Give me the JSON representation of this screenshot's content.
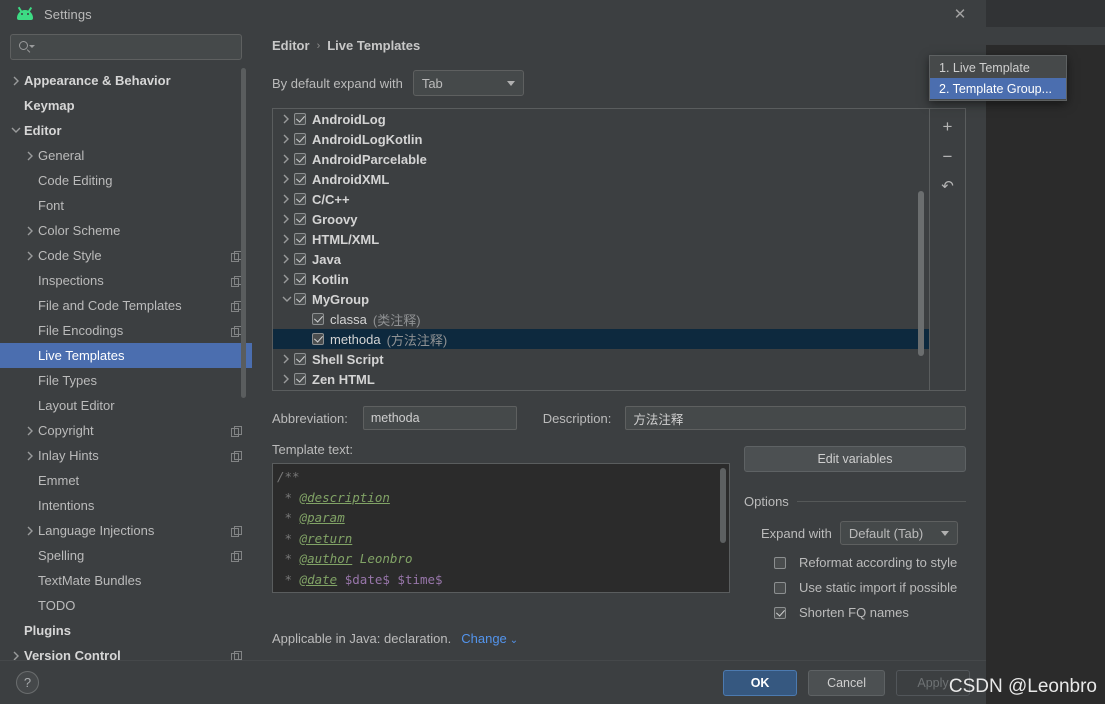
{
  "window": {
    "title": "Settings",
    "app_icon": "android-icon",
    "close_icon": "close-icon"
  },
  "search": {
    "value": "",
    "placeholder": "",
    "icon": "search-icon"
  },
  "sidebar": {
    "items": [
      {
        "label": "Appearance & Behavior",
        "twisty": "collapsed",
        "indent": 0,
        "bold": true,
        "copy": false,
        "selected": false
      },
      {
        "label": "Keymap",
        "twisty": "none",
        "indent": 0,
        "bold": true,
        "copy": false,
        "selected": false
      },
      {
        "label": "Editor",
        "twisty": "expanded",
        "indent": 0,
        "bold": true,
        "copy": false,
        "selected": false
      },
      {
        "label": "General",
        "twisty": "collapsed",
        "indent": 1,
        "bold": false,
        "copy": false,
        "selected": false
      },
      {
        "label": "Code Editing",
        "twisty": "none",
        "indent": 1,
        "bold": false,
        "copy": false,
        "selected": false
      },
      {
        "label": "Font",
        "twisty": "none",
        "indent": 1,
        "bold": false,
        "copy": false,
        "selected": false
      },
      {
        "label": "Color Scheme",
        "twisty": "collapsed",
        "indent": 1,
        "bold": false,
        "copy": false,
        "selected": false
      },
      {
        "label": "Code Style",
        "twisty": "collapsed",
        "indent": 1,
        "bold": false,
        "copy": true,
        "selected": false
      },
      {
        "label": "Inspections",
        "twisty": "none",
        "indent": 1,
        "bold": false,
        "copy": true,
        "selected": false
      },
      {
        "label": "File and Code Templates",
        "twisty": "none",
        "indent": 1,
        "bold": false,
        "copy": true,
        "selected": false
      },
      {
        "label": "File Encodings",
        "twisty": "none",
        "indent": 1,
        "bold": false,
        "copy": true,
        "selected": false
      },
      {
        "label": "Live Templates",
        "twisty": "none",
        "indent": 1,
        "bold": false,
        "copy": false,
        "selected": true
      },
      {
        "label": "File Types",
        "twisty": "none",
        "indent": 1,
        "bold": false,
        "copy": false,
        "selected": false
      },
      {
        "label": "Layout Editor",
        "twisty": "none",
        "indent": 1,
        "bold": false,
        "copy": false,
        "selected": false
      },
      {
        "label": "Copyright",
        "twisty": "collapsed",
        "indent": 1,
        "bold": false,
        "copy": true,
        "selected": false
      },
      {
        "label": "Inlay Hints",
        "twisty": "collapsed",
        "indent": 1,
        "bold": false,
        "copy": true,
        "selected": false
      },
      {
        "label": "Emmet",
        "twisty": "none",
        "indent": 1,
        "bold": false,
        "copy": false,
        "selected": false
      },
      {
        "label": "Intentions",
        "twisty": "none",
        "indent": 1,
        "bold": false,
        "copy": false,
        "selected": false
      },
      {
        "label": "Language Injections",
        "twisty": "collapsed",
        "indent": 1,
        "bold": false,
        "copy": true,
        "selected": false
      },
      {
        "label": "Spelling",
        "twisty": "none",
        "indent": 1,
        "bold": false,
        "copy": true,
        "selected": false
      },
      {
        "label": "TextMate Bundles",
        "twisty": "none",
        "indent": 1,
        "bold": false,
        "copy": false,
        "selected": false
      },
      {
        "label": "TODO",
        "twisty": "none",
        "indent": 1,
        "bold": false,
        "copy": false,
        "selected": false
      },
      {
        "label": "Plugins",
        "twisty": "none",
        "indent": 0,
        "bold": true,
        "copy": false,
        "selected": false
      },
      {
        "label": "Version Control",
        "twisty": "collapsed",
        "indent": 0,
        "bold": true,
        "copy": true,
        "selected": false
      }
    ]
  },
  "main": {
    "breadcrumb": {
      "parent": "Editor",
      "separator": "›",
      "current": "Live Templates"
    },
    "expand_with": {
      "label": "By default expand with",
      "value": "Tab"
    },
    "template_tree": [
      {
        "label": "AndroidLog",
        "twisty": "collapsed",
        "checked": true,
        "indent": 0,
        "bold": true,
        "desc": "",
        "selected": false
      },
      {
        "label": "AndroidLogKotlin",
        "twisty": "collapsed",
        "checked": true,
        "indent": 0,
        "bold": true,
        "desc": "",
        "selected": false
      },
      {
        "label": "AndroidParcelable",
        "twisty": "collapsed",
        "checked": true,
        "indent": 0,
        "bold": true,
        "desc": "",
        "selected": false
      },
      {
        "label": "AndroidXML",
        "twisty": "collapsed",
        "checked": true,
        "indent": 0,
        "bold": true,
        "desc": "",
        "selected": false
      },
      {
        "label": "C/C++",
        "twisty": "collapsed",
        "checked": true,
        "indent": 0,
        "bold": true,
        "desc": "",
        "selected": false
      },
      {
        "label": "Groovy",
        "twisty": "collapsed",
        "checked": true,
        "indent": 0,
        "bold": true,
        "desc": "",
        "selected": false
      },
      {
        "label": "HTML/XML",
        "twisty": "collapsed",
        "checked": true,
        "indent": 0,
        "bold": true,
        "desc": "",
        "selected": false
      },
      {
        "label": "Java",
        "twisty": "collapsed",
        "checked": true,
        "indent": 0,
        "bold": true,
        "desc": "",
        "selected": false
      },
      {
        "label": "Kotlin",
        "twisty": "collapsed",
        "checked": true,
        "indent": 0,
        "bold": true,
        "desc": "",
        "selected": false
      },
      {
        "label": "MyGroup",
        "twisty": "expanded",
        "checked": true,
        "indent": 0,
        "bold": true,
        "desc": "",
        "selected": false
      },
      {
        "label": "classa",
        "twisty": "none",
        "checked": true,
        "indent": 1,
        "bold": false,
        "desc": "(类注释)",
        "selected": false
      },
      {
        "label": "methoda",
        "twisty": "none",
        "checked": true,
        "indent": 1,
        "bold": false,
        "desc": "(方法注释)",
        "selected": true
      },
      {
        "label": "Shell Script",
        "twisty": "collapsed",
        "checked": true,
        "indent": 0,
        "bold": true,
        "desc": "",
        "selected": false
      },
      {
        "label": "Zen HTML",
        "twisty": "collapsed",
        "checked": true,
        "indent": 0,
        "bold": true,
        "desc": "",
        "selected": false
      }
    ],
    "toolbar": {
      "add_label": "+",
      "remove_label": "−",
      "revert_label": "↶"
    },
    "add_menu": {
      "open": true,
      "items": [
        {
          "label": "1. Live Template",
          "highlighted": false
        },
        {
          "label": "2. Template Group...",
          "highlighted": true
        }
      ]
    },
    "abbreviation": {
      "label": "Abbreviation:",
      "value": "methoda"
    },
    "description": {
      "label": "Description:",
      "value": "方法注释"
    },
    "template_text": {
      "caption": "Template text:",
      "lines": [
        {
          "segments": [
            {
              "text": "/**",
              "style": "cm"
            }
          ]
        },
        {
          "segments": [
            {
              "text": " * ",
              "style": "cm"
            },
            {
              "text": "@description",
              "style": "tag"
            }
          ]
        },
        {
          "segments": [
            {
              "text": " * ",
              "style": "cm"
            },
            {
              "text": "@param",
              "style": "tag"
            }
          ]
        },
        {
          "segments": [
            {
              "text": " * ",
              "style": "cm"
            },
            {
              "text": "@return",
              "style": "tag"
            }
          ]
        },
        {
          "segments": [
            {
              "text": " * ",
              "style": "cm"
            },
            {
              "text": "@author",
              "style": "tag"
            },
            {
              "text": " Leonbro",
              "style": "tagtxt"
            }
          ]
        },
        {
          "segments": [
            {
              "text": " * ",
              "style": "cm"
            },
            {
              "text": "@date",
              "style": "tag"
            },
            {
              "text": " ",
              "style": "cm"
            },
            {
              "text": "$date$ $time$",
              "style": "var"
            }
          ]
        },
        {
          "segments": [
            {
              "text": "*/",
              "style": "cm"
            }
          ]
        }
      ]
    },
    "edit_variables_button": "Edit variables",
    "options": {
      "title": "Options",
      "expand_with": {
        "label": "Expand with",
        "value": "Default (Tab)"
      },
      "checkboxes": [
        {
          "label": "Reformat according to style",
          "checked": false
        },
        {
          "label": "Use static import if possible",
          "checked": false
        },
        {
          "label": "Shorten FQ names",
          "checked": true
        }
      ]
    },
    "applicable": {
      "text": "Applicable in Java: declaration.",
      "link": "Change",
      "link_caret": "⌄"
    }
  },
  "footer": {
    "help_label": "?",
    "buttons": [
      {
        "label": "OK",
        "kind": "primary",
        "enabled": true
      },
      {
        "label": "Cancel",
        "kind": "normal",
        "enabled": true
      },
      {
        "label": "Apply",
        "kind": "disabled",
        "enabled": false
      }
    ]
  },
  "watermark": "CSDN @Leonbro",
  "colors": {
    "dialog_bg": "#3c3f41",
    "selection_blue": "#4b6eaf",
    "tree_selection": "#0d293e",
    "accent_link": "#5394ec",
    "primary_button": "#365880",
    "code_bg": "#2b2b2b",
    "tag_green": "#81a366",
    "variable_purple": "#9876aa",
    "android_green": "#3ddc84"
  }
}
